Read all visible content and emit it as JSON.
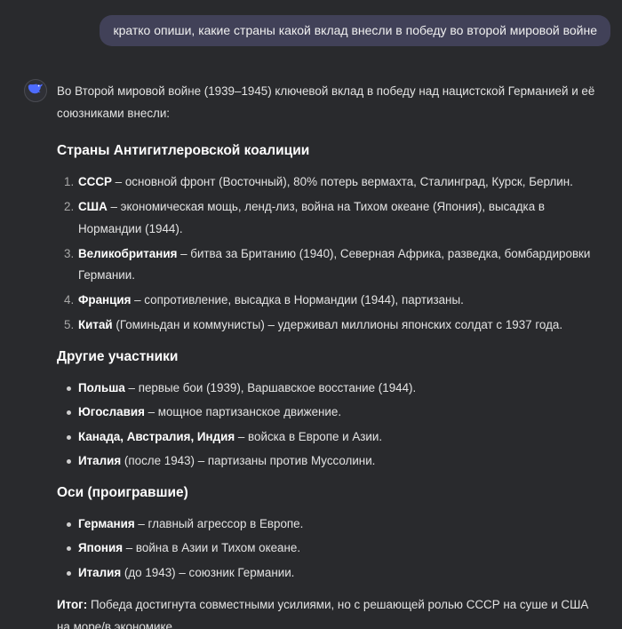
{
  "user_message": "кратко опиши, какие страны какой вклад внесли в победу во второй мировой войне",
  "assistant": {
    "avatar_icon": "whale-logo-icon",
    "accent": "#4d6bfe",
    "intro": "Во Второй мировой войне (1939–1945) ключевой вклад в победу над нацистской Германией и её союзниками внесли:",
    "sections": [
      {
        "title": "Страны Антигитлеровской коалиции",
        "items": [
          {
            "num": "1.",
            "bold": "СССР",
            "text": " – основной фронт (Восточный), 80% потерь вермахта, Сталинград, Курск, Берлин."
          },
          {
            "num": "2.",
            "bold": "США",
            "text": " – экономическая мощь, ленд-лиз, война на Тихом океане (Япония), высадка в Нормандии (1944)."
          },
          {
            "num": "3.",
            "bold": "Великобритания",
            "text": " – битва за Британию (1940), Северная Африка, разведка, бомбардировки Германии."
          },
          {
            "num": "4.",
            "bold": "Франция",
            "text": " – сопротивление, высадка в Нормандии (1944), партизаны."
          },
          {
            "num": "5.",
            "bold": "Китай",
            "text": " (Гоминьдан и коммунисты) – удерживал миллионы японских солдат с 1937 года."
          }
        ]
      },
      {
        "title": "Другие участники",
        "items": [
          {
            "bold": "Польша",
            "text": " – первые бои (1939), Варшавское восстание (1944)."
          },
          {
            "bold": "Югославия",
            "text": " – мощное партизанское движение."
          },
          {
            "bold": "Канада, Австралия, Индия",
            "text": " – войска в Европе и Азии."
          },
          {
            "bold": "Италия",
            "text": " (после 1943) – партизаны против Муссолини."
          }
        ]
      },
      {
        "title": "Оси (проигравшие)",
        "items": [
          {
            "bold": "Германия",
            "text": " – главный агрессор в Европе."
          },
          {
            "bold": "Япония",
            "text": " – война в Азии и Тихом океане."
          },
          {
            "bold": "Италия",
            "text": " (до 1943) – союзник Германии."
          }
        ]
      }
    ],
    "summary": {
      "bold": "Итог:",
      "text": " Победа достигнута совместными усилиями, но с решающей ролью СССР на суше и США на море/в экономике."
    }
  }
}
